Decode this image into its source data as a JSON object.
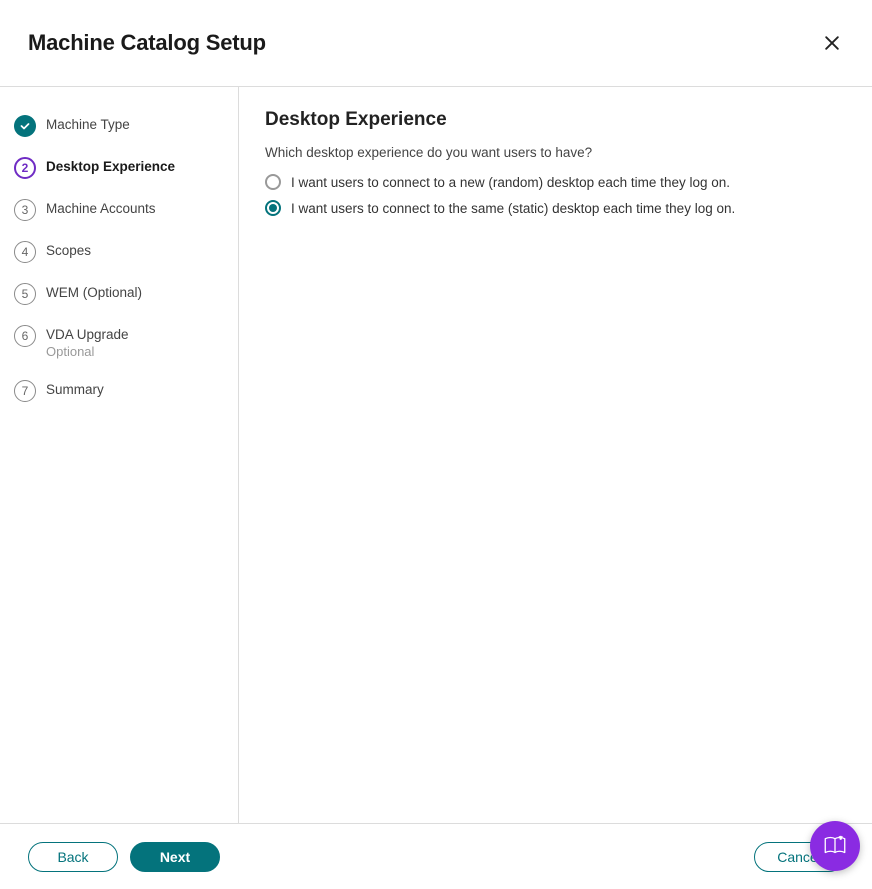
{
  "header": {
    "title": "Machine Catalog Setup"
  },
  "steps": [
    {
      "label": "Machine Type",
      "state": "completed",
      "name": "step-machine-type"
    },
    {
      "label": "Desktop Experience",
      "state": "current",
      "number": "2",
      "name": "step-desktop-experience"
    },
    {
      "label": "Machine Accounts",
      "state": "pending",
      "number": "3",
      "name": "step-machine-accounts"
    },
    {
      "label": "Scopes",
      "state": "pending",
      "number": "4",
      "name": "step-scopes"
    },
    {
      "label": "WEM (Optional)",
      "state": "pending",
      "number": "5",
      "name": "step-wem-optional"
    },
    {
      "label": "VDA Upgrade",
      "sublabel": "Optional",
      "state": "pending",
      "number": "6",
      "name": "step-vda-upgrade"
    },
    {
      "label": "Summary",
      "state": "pending",
      "number": "7",
      "name": "step-summary"
    }
  ],
  "panel": {
    "title": "Desktop Experience",
    "question": "Which desktop experience do you want users to have?",
    "options": [
      {
        "label": "I want users to connect to a new (random) desktop each time they log on.",
        "selected": false,
        "name": "radio-random-desktop"
      },
      {
        "label": "I want users to connect to the same (static) desktop each time they log on.",
        "selected": true,
        "name": "radio-static-desktop"
      }
    ]
  },
  "footer": {
    "back": "Back",
    "next": "Next",
    "cancel": "Cancel"
  }
}
